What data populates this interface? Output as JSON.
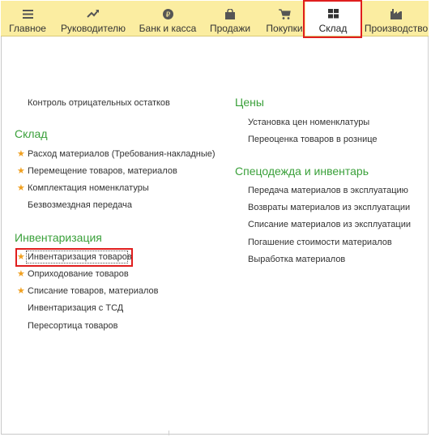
{
  "nav": {
    "tabs": [
      {
        "label": "Главное",
        "icon": "menu-icon"
      },
      {
        "label": "Руководителю",
        "icon": "trend-icon"
      },
      {
        "label": "Банк и касса",
        "icon": "coin-icon"
      },
      {
        "label": "Продажи",
        "icon": "bag-icon"
      },
      {
        "label": "Покупки",
        "icon": "cart-icon"
      },
      {
        "label": "Склад",
        "icon": "warehouse-icon",
        "active": true
      },
      {
        "label": "Производство",
        "icon": "factory-icon"
      }
    ]
  },
  "left": {
    "top_link": "Контроль отрицательных остатков",
    "sklad": {
      "heading": "Склад",
      "items": [
        "Расход материалов (Требования-накладные)",
        "Перемещение товаров, материалов",
        "Комплектация номенклатуры",
        "Безвозмездная передача"
      ]
    },
    "inv": {
      "heading": "Инвентаризация",
      "items": [
        "Инвентаризация товаров",
        "Оприходование товаров",
        "Списание товаров, материалов",
        "Инвентаризация с ТСД",
        "Пересортица товаров"
      ]
    }
  },
  "right": {
    "prices": {
      "heading": "Цены",
      "items": [
        "Установка цен номенклатуры",
        "Переоценка товаров в рознице"
      ]
    },
    "workwear": {
      "heading": "Спецодежда и инвентарь",
      "items": [
        "Передача материалов в эксплуатацию",
        "Возвраты материалов из эксплуатации",
        "Списание материалов из эксплуатации",
        "Погашение стоимости материалов",
        "Выработка материалов"
      ]
    }
  },
  "colors": {
    "topbar": "#fbeda1",
    "heading": "#3aa03a",
    "star": "#f0a020",
    "highlight": "#e01e1e"
  }
}
